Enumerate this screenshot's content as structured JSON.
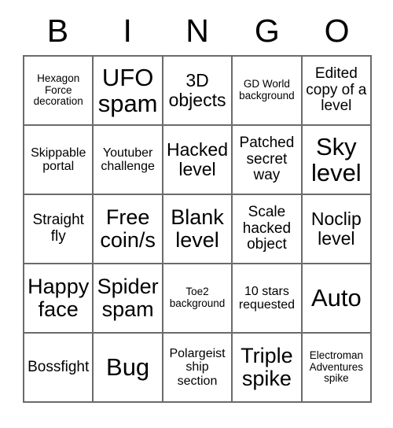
{
  "card": {
    "title_letters": [
      "B",
      "I",
      "N",
      "G",
      "O"
    ],
    "rows": [
      [
        {
          "text": "Hexagon Force decoration",
          "size": "fs-xs"
        },
        {
          "text": "UFO spam",
          "size": "fs-xxl"
        },
        {
          "text": "3D objects",
          "size": "fs-l"
        },
        {
          "text": "GD World background",
          "size": "fs-xs"
        },
        {
          "text": "Edited copy of a level",
          "size": "fs-m"
        }
      ],
      [
        {
          "text": "Skippable portal",
          "size": "fs-s"
        },
        {
          "text": "Youtuber challenge",
          "size": "fs-s"
        },
        {
          "text": "Hacked level",
          "size": "fs-l"
        },
        {
          "text": "Patched secret way",
          "size": "fs-m"
        },
        {
          "text": "Sky level",
          "size": "fs-xxl"
        }
      ],
      [
        {
          "text": "Straight fly",
          "size": "fs-m"
        },
        {
          "text": "Free coin/s",
          "size": "fs-xl"
        },
        {
          "text": "Blank level",
          "size": "fs-xl"
        },
        {
          "text": "Scale hacked object",
          "size": "fs-m"
        },
        {
          "text": "Noclip level",
          "size": "fs-l"
        }
      ],
      [
        {
          "text": "Happy face",
          "size": "fs-xl"
        },
        {
          "text": "Spider spam",
          "size": "fs-xl"
        },
        {
          "text": "Toe2 background",
          "size": "fs-xs"
        },
        {
          "text": "10 stars requested",
          "size": "fs-s"
        },
        {
          "text": "Auto",
          "size": "fs-xxl"
        }
      ],
      [
        {
          "text": "Bossfight",
          "size": "fs-m"
        },
        {
          "text": "Bug",
          "size": "fs-xxl"
        },
        {
          "text": "Polargeist ship section",
          "size": "fs-s"
        },
        {
          "text": "Triple spike",
          "size": "fs-xl"
        },
        {
          "text": "Electroman Adventures spike",
          "size": "fs-xs"
        }
      ]
    ]
  },
  "colors": {
    "border": "#6b6b6b",
    "text": "#000000",
    "background": "#ffffff"
  }
}
